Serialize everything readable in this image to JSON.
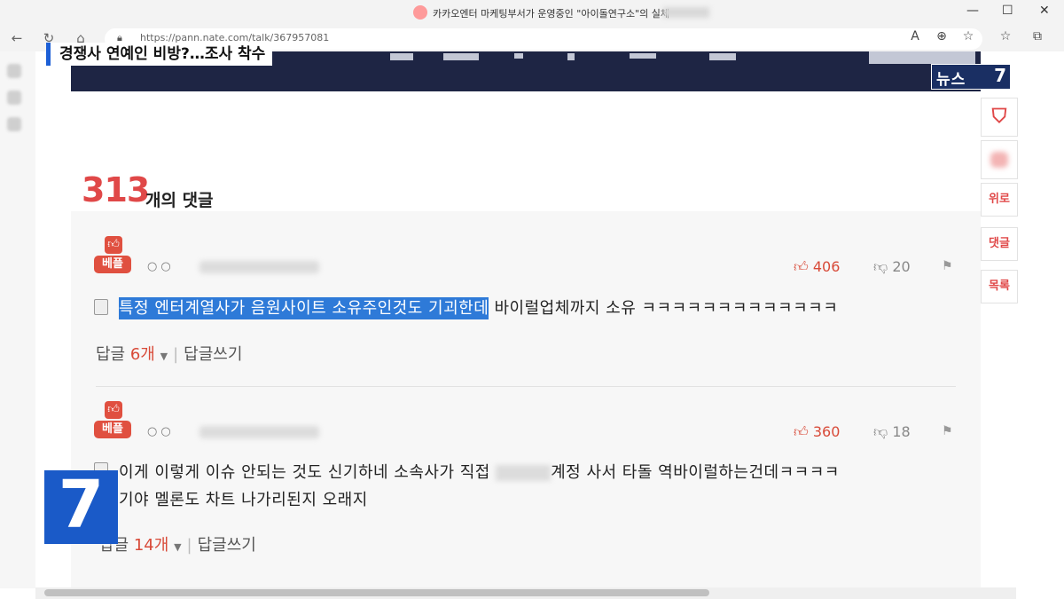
{
  "window": {
    "title": "카카오엔터 마케팅부서가 운영중인 \"아이돌연구소\"의 실체",
    "controls": [
      "—",
      "☐",
      "✕"
    ]
  },
  "browser": {
    "url": "https://pann.nate.com/talk/367957081",
    "toolbar_icons": [
      "read-aloud-icon",
      "zoom-icon",
      "favorite-add-icon",
      "favorites-icon",
      "collections-icon"
    ]
  },
  "overlay": {
    "caption": "경쟁사 연예인 비방?…조사 착수",
    "news_logo_text": "뉴스",
    "news_logo_num": "7",
    "channel_number": "7"
  },
  "sidebar": {
    "items": [
      {
        "label": "위로"
      },
      {
        "label": "댓글"
      },
      {
        "label": "목록"
      }
    ]
  },
  "comments_header": {
    "count": "313",
    "label": "개의 댓글"
  },
  "comments": [
    {
      "badge": "베플",
      "user_icons": "○○",
      "likes": "406",
      "dislikes": "20",
      "text_highlighted": "특정 엔터계열사가 음원사이트 소유주인것도 기괴한데",
      "text_rest": "바이럴업체까지 소유 ㅋㅋㅋㅋㅋㅋㅋㅋㅋㅋㅋㅋㅋ",
      "reply_label": "답글",
      "reply_count": "6개",
      "write_reply": "답글쓰기"
    },
    {
      "badge": "베플",
      "user_icons": "○○",
      "likes": "360",
      "dislikes": "18",
      "text_line1_a": "이게 이렇게 이슈 안되는 것도 신기하네 소속사가 직접",
      "text_line1_b": "계정 사서 타돌 역바이럴하는건데ㅋㅋㅋㅋ",
      "text_line2": "기야 멜론도 차트 나가리된지 오래지",
      "reply_label": "답글",
      "reply_count": "14개",
      "write_reply": "답글쓰기"
    }
  ],
  "colors": {
    "accent": "#e04848",
    "highlight": "#2e7ad8",
    "channel_blue": "#1a5ac8",
    "banner": "#1e2544"
  }
}
